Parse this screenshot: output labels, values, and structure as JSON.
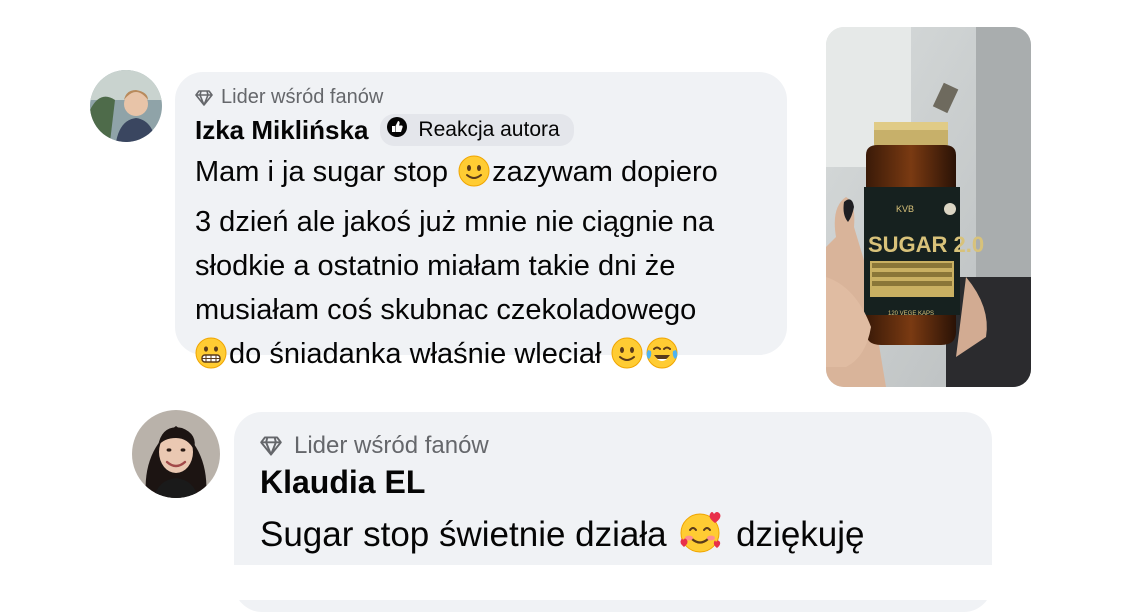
{
  "comment1": {
    "badge": "Lider wśród fanów",
    "author": "Izka Miklińska",
    "author_reaction": "Reakcja autora",
    "lines": [
      "Mam i ja sugar stop",
      "zazywam dopiero",
      "3 dzień ale jakoś już mnie nie ciągnie na",
      "słodkie a ostatnio miałam takie dni że",
      "musiałam coś skubnac czekoladowego",
      "do śniadanka właśnie wleciał"
    ],
    "photo": {
      "label_brand": "KVB",
      "label_product": "SUGAR 2.0",
      "label_caps": "120 VEGE KAPS"
    }
  },
  "comment2": {
    "badge": "Lider wśród fanów",
    "author": "Klaudia EL",
    "line1_a": "Sugar stop świetnie działa",
    "line1_b": "dziękuję"
  },
  "colors": {
    "bubble": "#f0f2f5",
    "pill": "#e4e6eb",
    "muted_text": "#65676b",
    "text": "#050505"
  },
  "icons": [
    "diamond-icon",
    "author-reaction-icon",
    "slightly-smiling-face-emoji",
    "grimacing-face-emoji",
    "tears-of-joy-emoji",
    "smiling-face-with-hearts-emoji"
  ]
}
